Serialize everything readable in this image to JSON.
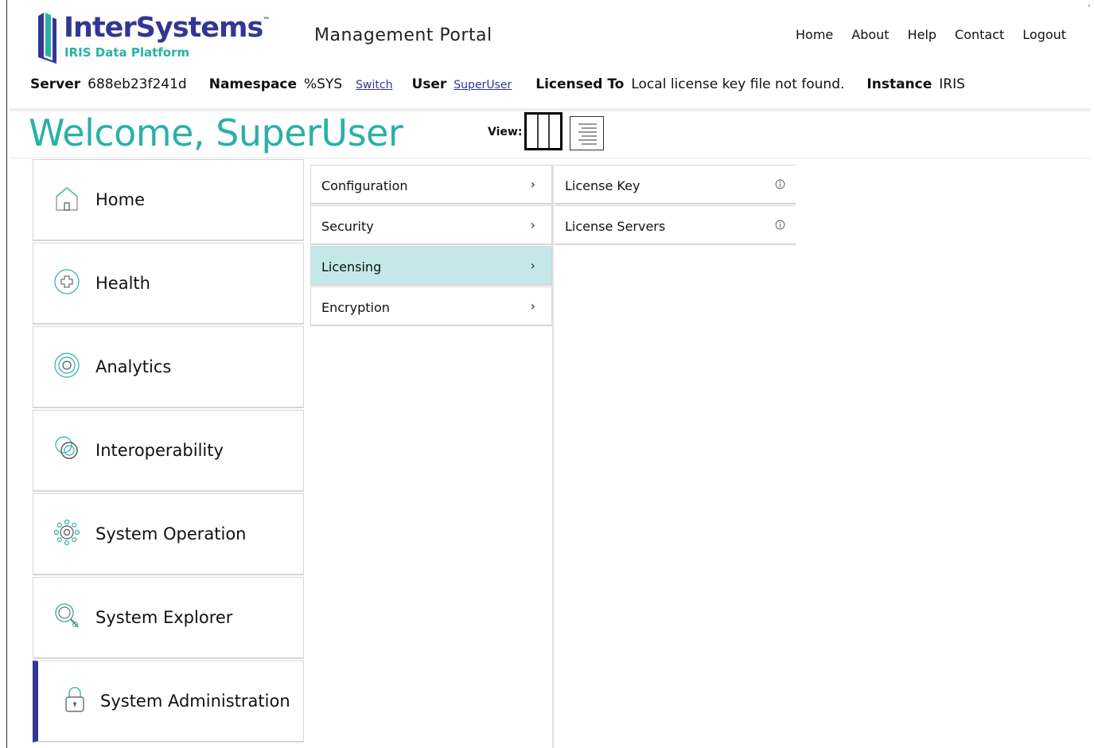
{
  "brand": {
    "name": "InterSystems",
    "trademark": "™",
    "product": "IRIS Data Platform",
    "primary_color": "#333695",
    "accent_color": "#2bb0a7"
  },
  "portal_title": "Management Portal",
  "top_nav": [
    "Home",
    "About",
    "Help",
    "Contact",
    "Logout"
  ],
  "info_bar": {
    "server_label": "Server",
    "server_value": "688eb23f241d",
    "namespace_label": "Namespace",
    "namespace_value": "%SYS",
    "switch_link": "Switch",
    "user_label": "User",
    "user_value": "SuperUser",
    "licensed_label": "Licensed To",
    "licensed_value": "Local license key file not found.",
    "instance_label": "Instance",
    "instance_value": "IRIS"
  },
  "welcome": "Welcome, SuperUser",
  "view": {
    "label": "View:",
    "selected": "columns",
    "options": [
      "columns-icon",
      "list-icon"
    ]
  },
  "main_menu": [
    {
      "label": "Home",
      "icon": "home-icon"
    },
    {
      "label": "Health",
      "icon": "health-icon"
    },
    {
      "label": "Analytics",
      "icon": "analytics-icon"
    },
    {
      "label": "Interoperability",
      "icon": "interoperability-icon"
    },
    {
      "label": "System Operation",
      "icon": "gear-icon"
    },
    {
      "label": "System Explorer",
      "icon": "explorer-search-icon"
    },
    {
      "label": "System Administration",
      "icon": "lock-icon",
      "active": true
    }
  ],
  "submenu": [
    {
      "label": "Configuration"
    },
    {
      "label": "Security"
    },
    {
      "label": "Licensing",
      "selected": true
    },
    {
      "label": "Encryption"
    }
  ],
  "licensing_items": [
    {
      "label": "License Key"
    },
    {
      "label": "License Servers"
    }
  ],
  "selected_color": "#c4e8e8"
}
